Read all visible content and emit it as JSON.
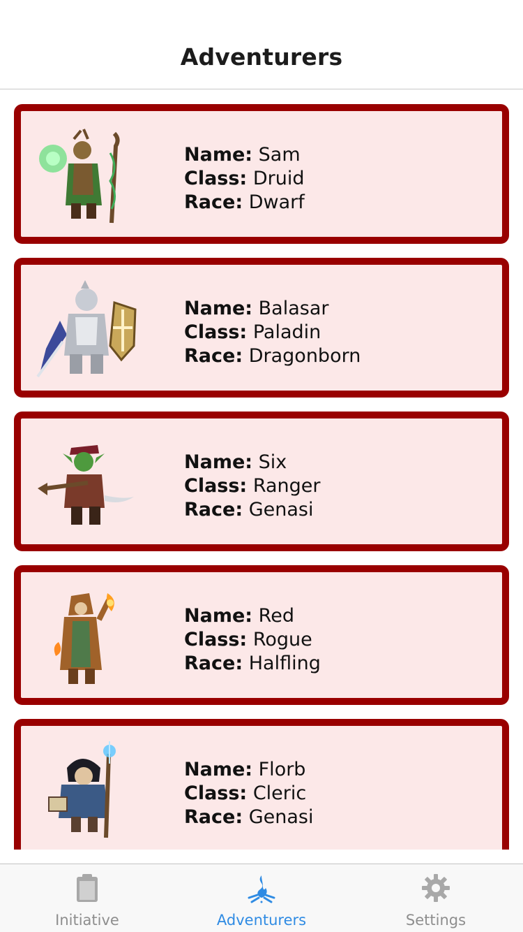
{
  "header": {
    "title": "Adventurers"
  },
  "labels": {
    "name": "Name:",
    "class": "Class:",
    "race": "Race:"
  },
  "adventurers": [
    {
      "name": "Sam",
      "class": "Druid",
      "race": "Dwarf",
      "portrait_icon": "druid-portrait-icon",
      "accent": "#3a7a2e"
    },
    {
      "name": "Balasar",
      "class": "Paladin",
      "race": "Dragonborn",
      "portrait_icon": "paladin-portrait-icon",
      "accent": "#b8bcc4"
    },
    {
      "name": "Six",
      "class": "Ranger",
      "race": "Genasi",
      "portrait_icon": "ranger-portrait-icon",
      "accent": "#3f8f3a"
    },
    {
      "name": "Red",
      "class": "Rogue",
      "race": "Halfling",
      "portrait_icon": "rogue-portrait-icon",
      "accent": "#a0622a"
    },
    {
      "name": "Florb",
      "class": "Cleric",
      "race": "Genasi",
      "portrait_icon": "cleric-portrait-icon",
      "accent": "#3b5a86"
    }
  ],
  "tabs": [
    {
      "label": "Initiative",
      "icon": "clipboard-icon",
      "active": false
    },
    {
      "label": "Adventurers",
      "icon": "campfire-icon",
      "active": true
    },
    {
      "label": "Settings",
      "icon": "gear-icon",
      "active": false
    }
  ],
  "colors": {
    "card_border": "#990000",
    "card_bg": "#fce8e8",
    "tab_active": "#2f8be3",
    "tab_inactive": "#8e8e8e"
  }
}
